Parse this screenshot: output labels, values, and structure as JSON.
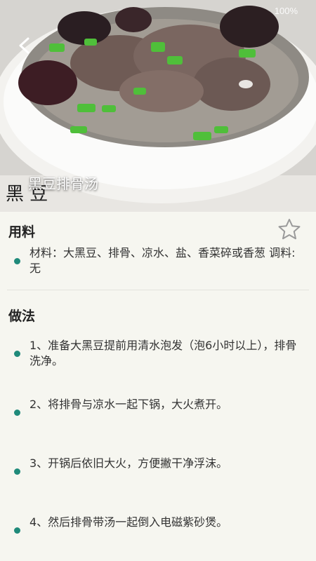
{
  "status_bar": {
    "left_text": "",
    "right_text": "100%"
  },
  "recipe": {
    "title": "黑豆排骨汤"
  },
  "ingredients": {
    "heading": "用料",
    "items": [
      "材料：大黑豆、排骨、凉水、盐、香菜碎或香葱 调料:无"
    ]
  },
  "method": {
    "heading": "做法",
    "steps": [
      "1、准备大黑豆提前用清水泡发（泡6小时以上），排骨洗净。",
      "2、将排骨与凉水一起下锅，大火煮开。",
      "3、开锅后依旧大火，方便撇干净浮沫。",
      "4、然后排骨带汤一起倒入电磁紫砂煲。"
    ]
  },
  "colors": {
    "accent": "#1f8a7a",
    "background": "#f6f6f0"
  },
  "icons": [
    "back-arrow-icon",
    "star-outline-icon"
  ]
}
